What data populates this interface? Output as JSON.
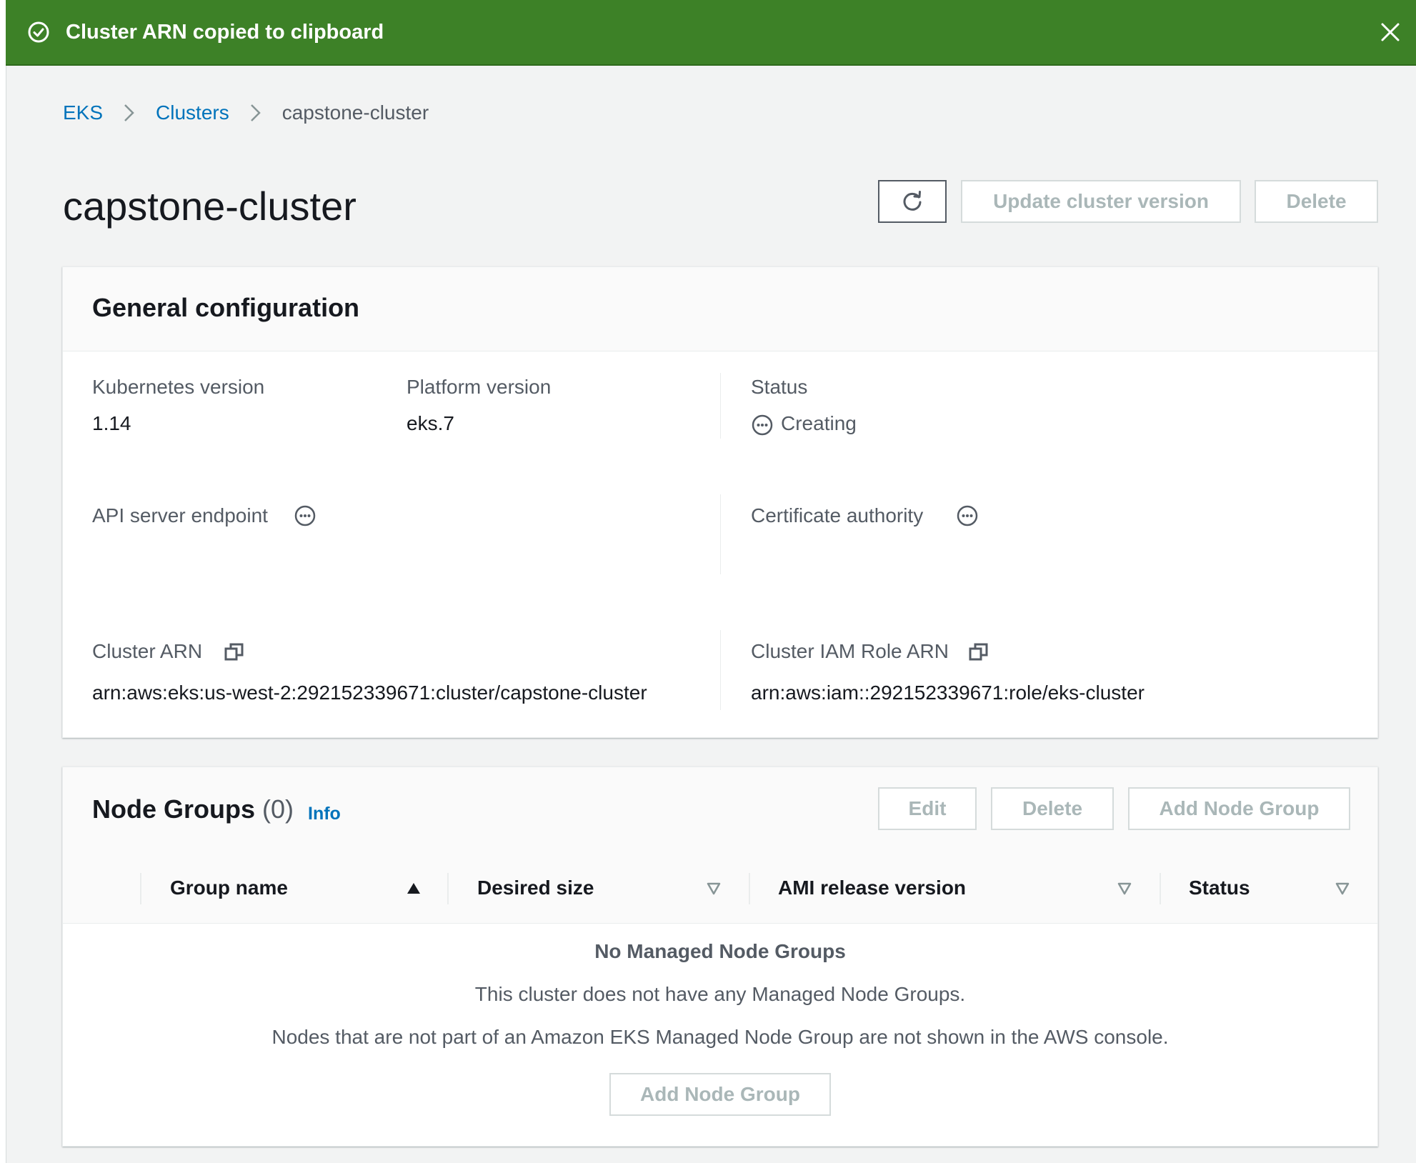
{
  "flash": {
    "message": "Cluster ARN copied to clipboard",
    "status_icon": "success-check-icon",
    "close_icon": "close-icon",
    "color": "#3d8127"
  },
  "breadcrumb": {
    "items": [
      "EKS",
      "Clusters",
      "capstone-cluster"
    ]
  },
  "header": {
    "title": "capstone-cluster",
    "refresh_icon": "refresh-icon",
    "update_label": "Update cluster version",
    "delete_label": "Delete"
  },
  "general": {
    "title": "General configuration",
    "kubernetes_version_label": "Kubernetes version",
    "kubernetes_version": "1.14",
    "platform_version_label": "Platform version",
    "platform_version": "eks.7",
    "status_label": "Status",
    "status_value": "Creating",
    "api_endpoint_label": "API server endpoint",
    "cert_authority_label": "Certificate authority",
    "cluster_arn_label": "Cluster ARN",
    "cluster_arn": "arn:aws:eks:us-west-2:292152339671:cluster/capstone-cluster",
    "iam_role_arn_label": "Cluster IAM Role ARN",
    "iam_role_arn": "arn:aws:iam::292152339671:role/eks-cluster"
  },
  "node_groups": {
    "title": "Node Groups",
    "count": "(0)",
    "info_label": "Info",
    "edit_label": "Edit",
    "delete_label": "Delete",
    "add_label": "Add Node Group",
    "columns": [
      "Group name",
      "Desired size",
      "AMI release version",
      "Status"
    ],
    "empty_title": "No Managed Node Groups",
    "empty_line1": "This cluster does not have any Managed Node Groups.",
    "empty_line2": "Nodes that are not part of an Amazon EKS Managed Node Group are not shown in the AWS console.",
    "empty_add_label": "Add Node Group"
  },
  "colors": {
    "link": "#0073bb",
    "success": "#3d8127",
    "disabled_text": "#aab7b8"
  }
}
